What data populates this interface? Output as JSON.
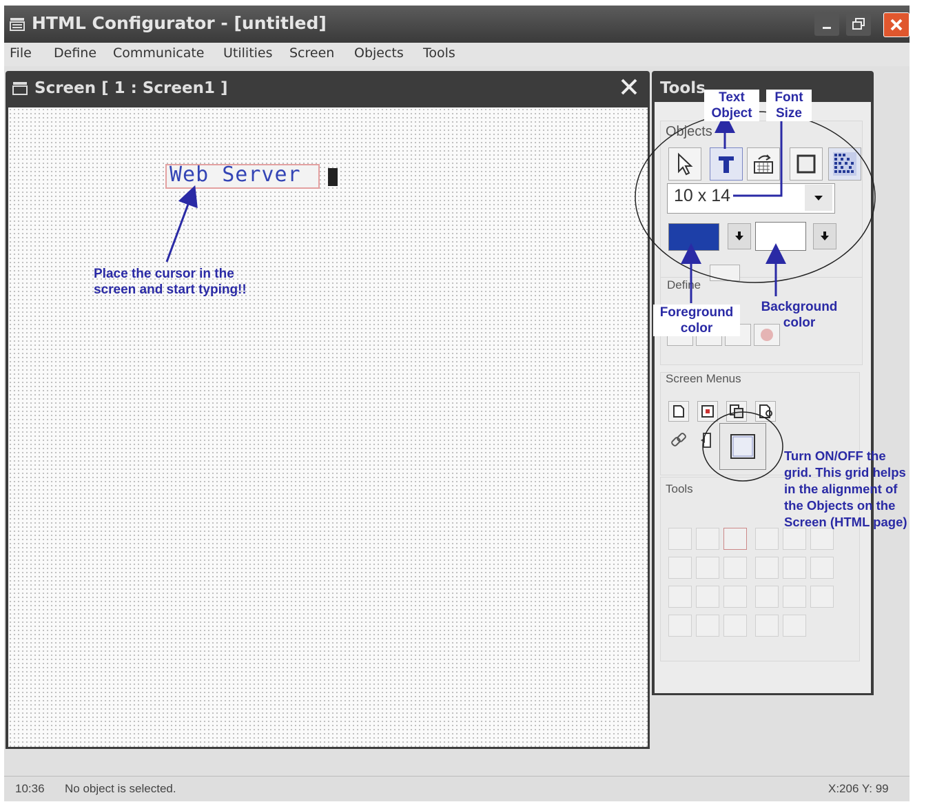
{
  "window": {
    "title": "HTML Configurator - [untitled]"
  },
  "menu": [
    "File",
    "Define",
    "Communicate",
    "Utilities",
    "Screen",
    "Objects",
    "Tools"
  ],
  "screen_window": {
    "title": "Screen [ 1 : Screen1 ]",
    "text_object": "Web Server"
  },
  "tools_panel": {
    "title": "Tools",
    "objects_label": "Objects",
    "font_size": "10 x 14",
    "define_label": "Define",
    "screen_menus_label": "Screen Menus",
    "tools_label": "Tools",
    "foreground_color": "#1d3fa8",
    "background_color": "#ffffff"
  },
  "status": {
    "time": "10:36",
    "message": "No object is selected.",
    "coords": "X:206 Y: 99"
  },
  "annotations": {
    "text_object": [
      "Text",
      "Object"
    ],
    "font_size": [
      "Font",
      "Size"
    ],
    "foreground": [
      "Foreground",
      "color"
    ],
    "background": [
      "Background",
      "color"
    ],
    "cursor_hint": [
      "Place the cursor in the",
      "screen and start typing!!"
    ],
    "grid_hint": [
      "Turn ON/OFF the",
      "grid. This grid helps",
      "in the alignment of",
      "the Objects on the",
      "Screen (HTML page)"
    ]
  }
}
